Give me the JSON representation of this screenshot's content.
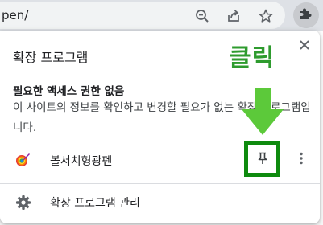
{
  "toolbar": {
    "url_text": "pen/",
    "icons": [
      "zoom-out-icon",
      "share-icon",
      "star-icon",
      "puzzle-icon"
    ]
  },
  "popup": {
    "title": "확장 프로그램",
    "section_heading": "필요한 액세스 권한 없음",
    "section_desc": "이 사이트의 정보를 확인하고 변경할 필요가 없는 확장 프로그램입니다.",
    "extension": {
      "name": "볼서치형광펜",
      "logo_icon": "rainbow-brush-icon",
      "pin_icon": "pin-icon",
      "more_icon": "more-vertical-icon"
    },
    "manage_label": "확장 프로그램 관리",
    "manage_icon": "gear-icon",
    "close_icon": "close-icon"
  },
  "annotation": {
    "text": "클릭",
    "color": "#2e9b2e",
    "box_color": "#0e8a0e"
  },
  "colors": {
    "toolbar_bg": "#dee1e6",
    "omnibox_bg": "#f1f3f4",
    "active_button_bg": "#c8cace",
    "icon_gray": "#5f6368"
  }
}
